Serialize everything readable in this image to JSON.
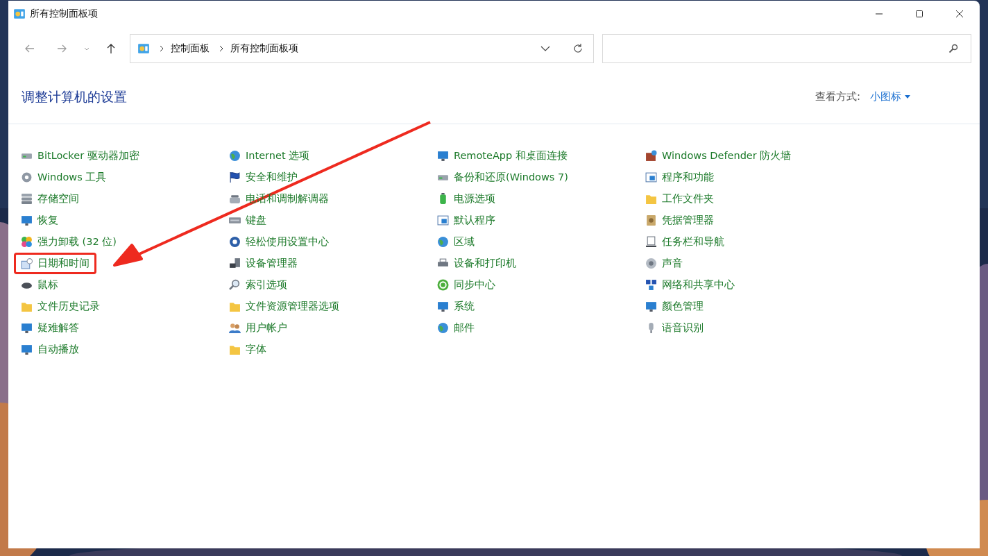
{
  "window": {
    "title": "所有控制面板项"
  },
  "address_bar": {
    "path": [
      "控制面板",
      "所有控制面板项"
    ]
  },
  "heading": "调整计算机的设置",
  "view_by": {
    "label": "查看方式:",
    "value": "小图标"
  },
  "columns": [
    {
      "items": [
        {
          "label": "BitLocker 驱动器加密",
          "highlighted": false
        },
        {
          "label": "Windows 工具",
          "highlighted": false
        },
        {
          "label": "存储空间",
          "highlighted": false
        },
        {
          "label": "恢复",
          "highlighted": false
        },
        {
          "label": "强力卸载 (32 位)",
          "highlighted": false
        },
        {
          "label": "日期和时间",
          "highlighted": true
        },
        {
          "label": "鼠标",
          "highlighted": false
        },
        {
          "label": "文件历史记录",
          "highlighted": false
        },
        {
          "label": "疑难解答",
          "highlighted": false
        },
        {
          "label": "自动播放",
          "highlighted": false
        }
      ]
    },
    {
      "items": [
        {
          "label": "Internet 选项",
          "highlighted": false
        },
        {
          "label": "安全和维护",
          "highlighted": false
        },
        {
          "label": "电话和调制解调器",
          "highlighted": false
        },
        {
          "label": "键盘",
          "highlighted": false
        },
        {
          "label": "轻松使用设置中心",
          "highlighted": false
        },
        {
          "label": "设备管理器",
          "highlighted": false
        },
        {
          "label": "索引选项",
          "highlighted": false
        },
        {
          "label": "文件资源管理器选项",
          "highlighted": false
        },
        {
          "label": "用户帐户",
          "highlighted": false
        },
        {
          "label": "字体",
          "highlighted": false
        }
      ]
    },
    {
      "items": [
        {
          "label": "RemoteApp 和桌面连接",
          "highlighted": false
        },
        {
          "label": "备份和还原(Windows 7)",
          "highlighted": false
        },
        {
          "label": "电源选项",
          "highlighted": false
        },
        {
          "label": "默认程序",
          "highlighted": false
        },
        {
          "label": "区域",
          "highlighted": false
        },
        {
          "label": "设备和打印机",
          "highlighted": false
        },
        {
          "label": "同步中心",
          "highlighted": false
        },
        {
          "label": "系统",
          "highlighted": false
        },
        {
          "label": "邮件",
          "highlighted": false
        }
      ]
    },
    {
      "items": [
        {
          "label": "Windows Defender 防火墙",
          "highlighted": false
        },
        {
          "label": "程序和功能",
          "highlighted": false
        },
        {
          "label": "工作文件夹",
          "highlighted": false
        },
        {
          "label": "凭据管理器",
          "highlighted": false
        },
        {
          "label": "任务栏和导航",
          "highlighted": false
        },
        {
          "label": "声音",
          "highlighted": false
        },
        {
          "label": "网络和共享中心",
          "highlighted": false
        },
        {
          "label": "颜色管理",
          "highlighted": false
        },
        {
          "label": "语音识别",
          "highlighted": false
        }
      ]
    }
  ]
}
